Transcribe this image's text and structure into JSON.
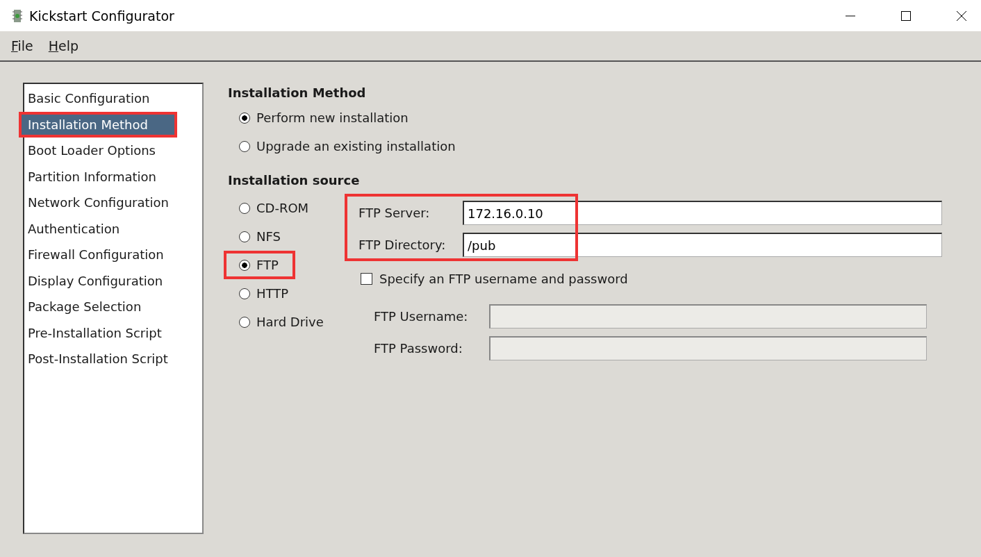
{
  "window": {
    "title": "Kickstart Configurator"
  },
  "menu": [
    {
      "label": "File"
    },
    {
      "label": "Help"
    }
  ],
  "sidebar": {
    "items": [
      {
        "label": "Basic Configuration",
        "selected": false,
        "highlighted": false
      },
      {
        "label": "Installation Method",
        "selected": true,
        "highlighted": true
      },
      {
        "label": "Boot Loader Options",
        "selected": false,
        "highlighted": false
      },
      {
        "label": "Partition Information",
        "selected": false,
        "highlighted": false
      },
      {
        "label": "Network Configuration",
        "selected": false,
        "highlighted": false
      },
      {
        "label": "Authentication",
        "selected": false,
        "highlighted": false
      },
      {
        "label": "Firewall Configuration",
        "selected": false,
        "highlighted": false
      },
      {
        "label": "Display Configuration",
        "selected": false,
        "highlighted": false
      },
      {
        "label": "Package Selection",
        "selected": false,
        "highlighted": false
      },
      {
        "label": "Pre-Installation Script",
        "selected": false,
        "highlighted": false
      },
      {
        "label": "Post-Installation Script",
        "selected": false,
        "highlighted": false
      }
    ]
  },
  "installation_method": {
    "heading": "Installation Method",
    "options": [
      {
        "label": "Perform new installation",
        "selected": true
      },
      {
        "label": "Upgrade an existing installation",
        "selected": false
      }
    ]
  },
  "installation_source": {
    "heading": "Installation source",
    "options": [
      {
        "label": "CD-ROM",
        "selected": false,
        "highlighted": false
      },
      {
        "label": "NFS",
        "selected": false,
        "highlighted": false
      },
      {
        "label": "FTP",
        "selected": true,
        "highlighted": true
      },
      {
        "label": "HTTP",
        "selected": false,
        "highlighted": false
      },
      {
        "label": "Hard Drive",
        "selected": false,
        "highlighted": false
      }
    ]
  },
  "ftp": {
    "fields_highlighted": true,
    "fields": [
      {
        "label": "FTP Server:",
        "value": "172.16.0.10",
        "disabled": false
      },
      {
        "label": "FTP Directory:",
        "value": "/pub",
        "disabled": false
      }
    ],
    "auth_checkbox": {
      "label": "Specify an FTP username and password",
      "checked": false
    },
    "auth_fields": [
      {
        "label": "FTP Username:",
        "disabled": true
      },
      {
        "label": "FTP Password:",
        "disabled": true
      }
    ]
  }
}
